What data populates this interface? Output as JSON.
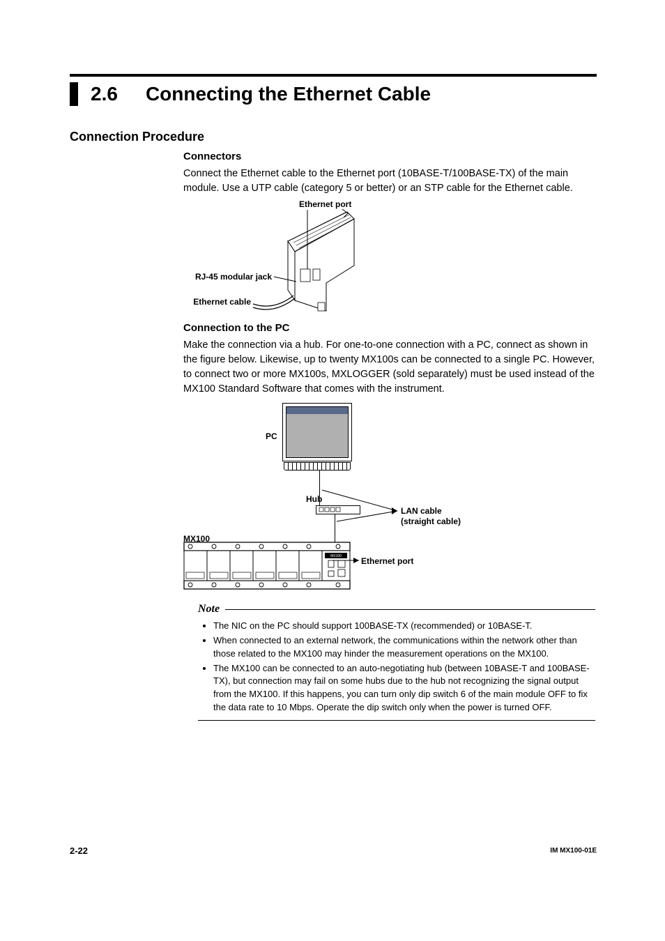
{
  "section_number": "2.6",
  "section_title": "Connecting the Ethernet Cable",
  "h2_procedure": "Connection Procedure",
  "connectors": {
    "heading": "Connectors",
    "text": "Connect the Ethernet cable to the Ethernet port (10BASE-T/100BASE-TX) of the main module. Use a UTP cable (category 5 or better) or an STP cable for the Ethernet cable."
  },
  "fig1_labels": {
    "ethernet_port": "Ethernet port",
    "rj45": "RJ-45 modular jack",
    "ecable": "Ethernet cable"
  },
  "conn_pc": {
    "heading": "Connection to the PC",
    "text": "Make the connection via a hub. For one-to-one connection with a PC, connect as shown in the figure below. Likewise, up to twenty MX100s can be connected to a single PC. However, to connect two or more MX100s, MXLOGGER (sold separately) must be used instead of the MX100 Standard Software that comes with the instrument."
  },
  "fig2_labels": {
    "pc": "PC",
    "hub": "Hub",
    "lan1": "LAN cable",
    "lan2": "(straight cable)",
    "mx100": "MX100",
    "eport": "Ethernet port",
    "mx_small": "MX100"
  },
  "note": {
    "word": "Note",
    "items": [
      "The NIC on the PC should support 100BASE-TX (recommended) or 10BASE-T.",
      "When connected to an external network, the communications within the network other than those related to the MX100 may hinder the measurement operations on the MX100.",
      "The MX100 can be connected to an auto-negotiating hub (between 10BASE-T and 100BASE-TX), but connection may fail on some hubs due to the hub not recognizing the signal output from the MX100. If this happens, you can turn only dip switch 6 of the main module OFF to fix the data rate to 10 Mbps. Operate the dip switch only when the power is turned OFF."
    ]
  },
  "page_number": "2-22",
  "doc_id": "IM MX100-01E"
}
